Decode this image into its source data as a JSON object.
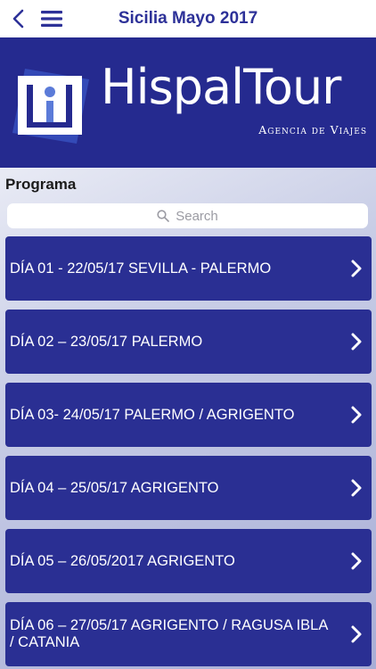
{
  "nav": {
    "title": "Sicilia Mayo 2017"
  },
  "banner": {
    "brand": "HispalTour",
    "tagline": "Agencia de Viajes",
    "bg_color": "#252a8f"
  },
  "section": {
    "title": "Programa"
  },
  "search": {
    "placeholder": "Search"
  },
  "items": [
    {
      "label": "DÍA 01 - 22/05/17 SEVILLA -  PALERMO"
    },
    {
      "label": "DÍA 02 – 23/05/17  PALERMO"
    },
    {
      "label": "DÍA 03- 24/05/17 PALERMO / AGRIGENTO"
    },
    {
      "label": "DÍA 04 – 25/05/17 AGRIGENTO"
    },
    {
      "label": "DÍA 05 – 26/05/2017 AGRIGENTO"
    },
    {
      "label": "DÍA 06 – 27/05/17 AGRIGENTO / RAGUSA IBLA / CATANIA"
    }
  ],
  "icons": {
    "back": "chevron-left-icon",
    "menu": "hamburger-menu-icon",
    "search": "search-icon",
    "row": "chevron-right-icon"
  },
  "colors": {
    "accent": "#2d3198",
    "item_bg": "#2a2f93"
  }
}
